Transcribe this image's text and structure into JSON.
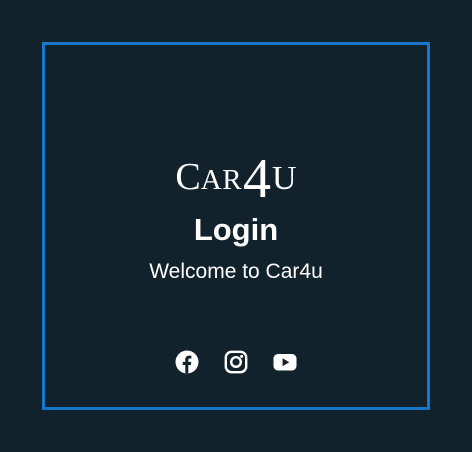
{
  "logo": {
    "c": "C",
    "ar": "AR",
    "four": "4",
    "u": "U"
  },
  "login": {
    "title": "Login",
    "subtitle": "Welcome to Car4u"
  },
  "socials": [
    {
      "icon": "facebook-icon"
    },
    {
      "icon": "instagram-icon"
    },
    {
      "icon": "youtube-icon"
    }
  ],
  "colors": {
    "background": "#12222d",
    "frame": "#1877c9",
    "text": "#ffffff"
  }
}
